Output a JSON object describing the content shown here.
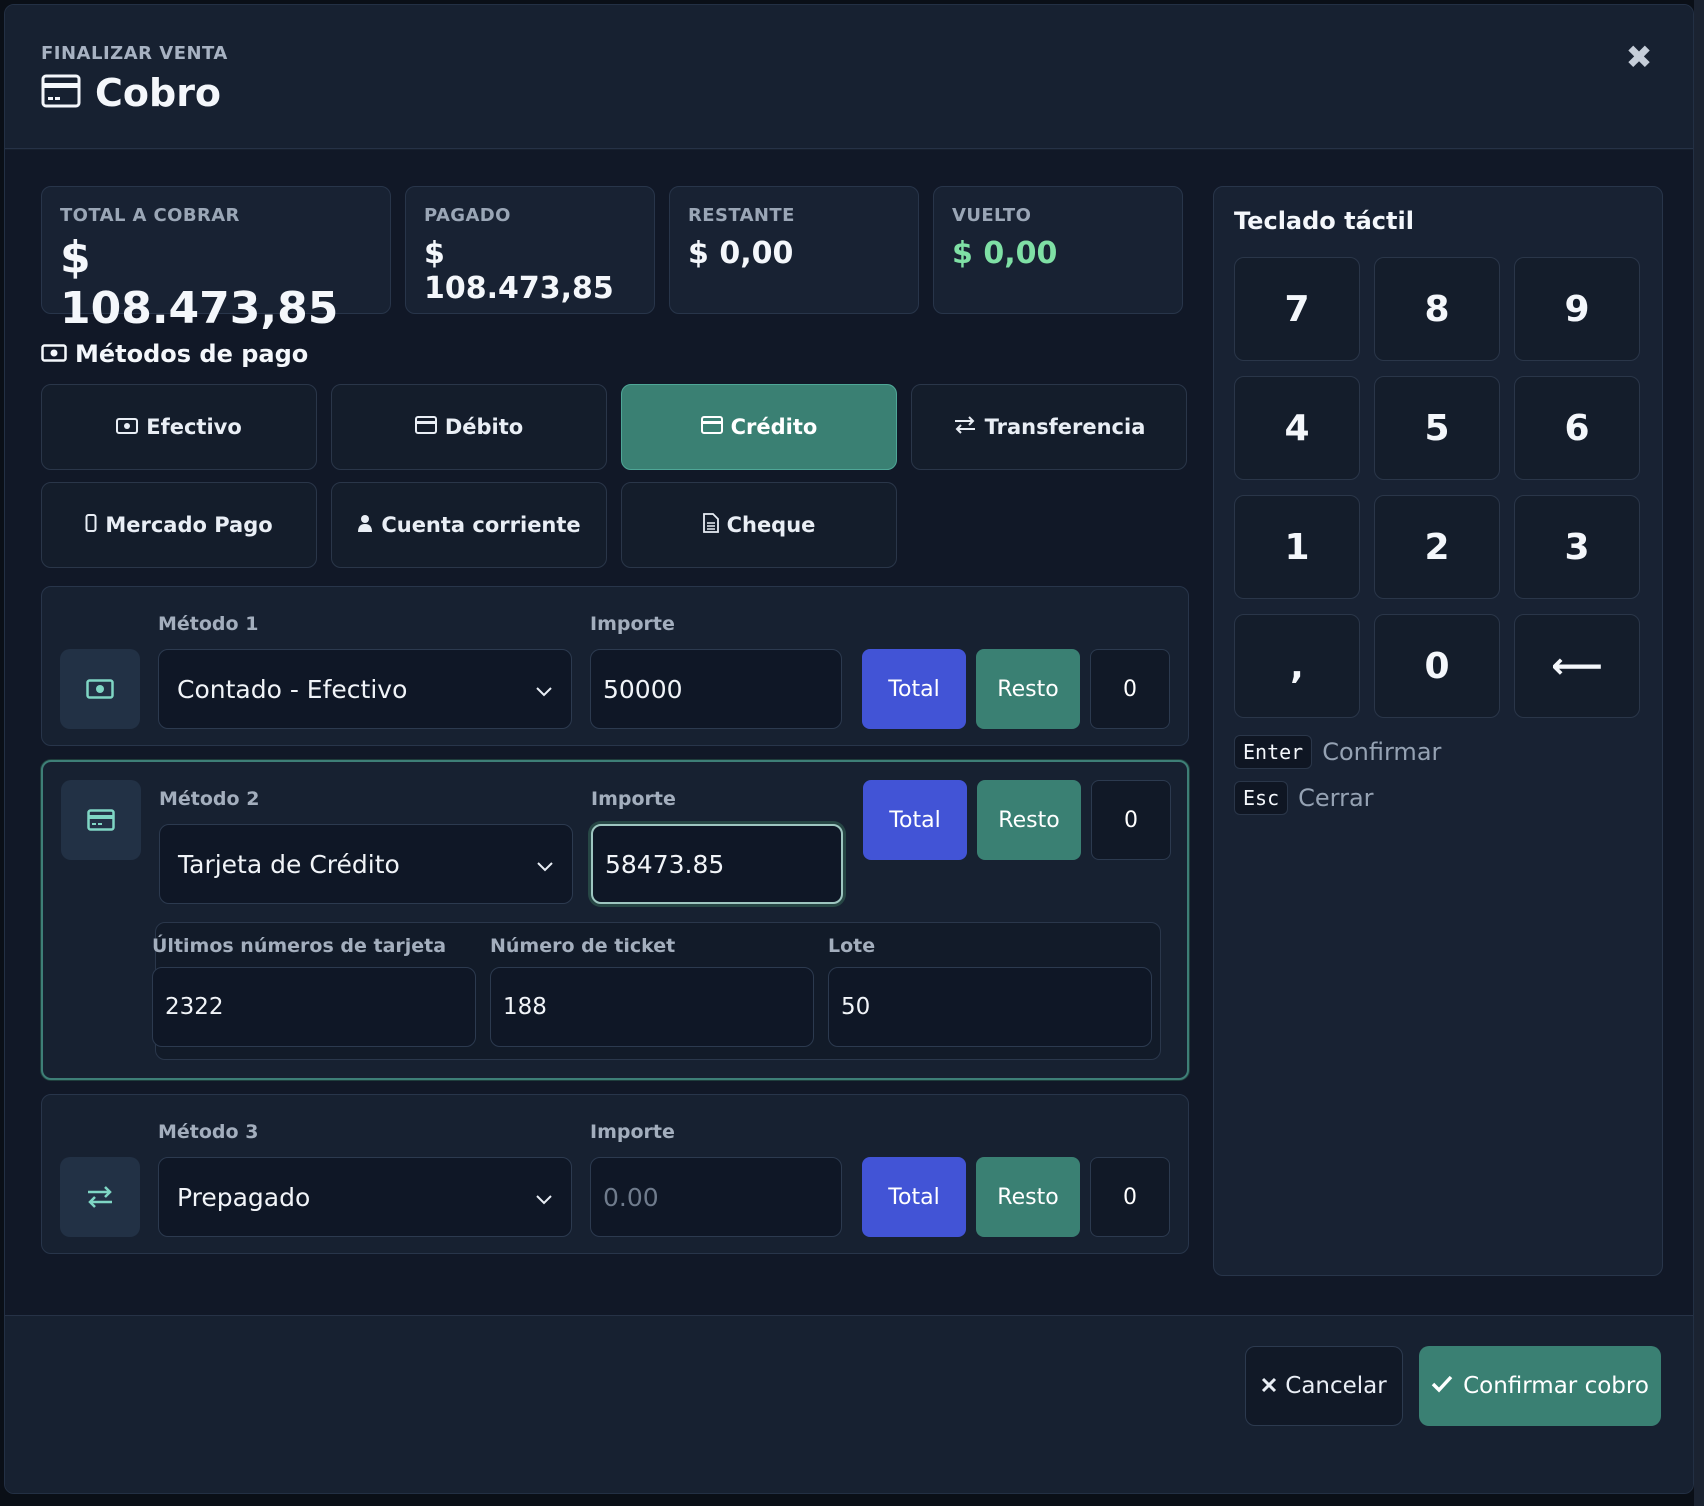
{
  "header": {
    "eyebrow": "FINALIZAR VENTA",
    "title": "Cobro",
    "close_label": "✖"
  },
  "summary": {
    "total": {
      "label": "TOTAL A COBRAR",
      "value": "$ 108.473,85"
    },
    "paid": {
      "label": "PAGADO",
      "value": "$ 108.473,85"
    },
    "remaining": {
      "label": "RESTANTE",
      "value": "$ 0,00"
    },
    "change": {
      "label": "VUELTO",
      "value": "$ 0,00"
    }
  },
  "methods_section": {
    "title": "Métodos de pago",
    "buttons": [
      {
        "label": "Efectivo",
        "icon": "cash-icon",
        "active": false
      },
      {
        "label": "Débito",
        "icon": "card-icon",
        "active": false
      },
      {
        "label": "Crédito",
        "icon": "card-icon",
        "active": true
      },
      {
        "label": "Transferencia",
        "icon": "transfer-icon",
        "active": false
      },
      {
        "label": "Mercado Pago",
        "icon": "phone-icon",
        "active": false
      },
      {
        "label": "Cuenta corriente",
        "icon": "user-icon",
        "active": false
      },
      {
        "label": "Cheque",
        "icon": "document-icon",
        "active": false
      }
    ]
  },
  "payment_rows": [
    {
      "method_label": "Método 1",
      "amount_label": "Importe",
      "method": "Contado - Efectivo",
      "amount": "50000",
      "amount_placeholder": "0.00",
      "total_label": "Total",
      "rest_label": "Resto",
      "zero_label": "0",
      "icon": "cash-icon"
    },
    {
      "method_label": "Método 2",
      "amount_label": "Importe",
      "method": "Tarjeta de Crédito",
      "amount": "58473.85",
      "amount_placeholder": "0.00",
      "total_label": "Total",
      "rest_label": "Resto",
      "zero_label": "0",
      "icon": "card-icon",
      "card_details": {
        "last_digits_label": "Últimos números de tarjeta",
        "last_digits": "2322",
        "ticket_label": "Número de ticket",
        "ticket": "188",
        "batch_label": "Lote",
        "batch": "50"
      }
    },
    {
      "method_label": "Método 3",
      "amount_label": "Importe",
      "method": "Prepagado",
      "amount": "",
      "amount_placeholder": "0.00",
      "total_label": "Total",
      "rest_label": "Resto",
      "zero_label": "0",
      "icon": "transfer-icon"
    }
  ],
  "keypad": {
    "title": "Teclado táctil",
    "keys": [
      "7",
      "8",
      "9",
      "4",
      "5",
      "6",
      "1",
      "2",
      "3",
      ",",
      "0",
      "⟵"
    ],
    "shortcuts": [
      {
        "key": "Enter",
        "label": "Confirmar"
      },
      {
        "key": "Esc",
        "label": "Cerrar"
      }
    ]
  },
  "footer": {
    "cancel_label": "Cancelar",
    "confirm_label": "Confirmar cobro"
  },
  "colors": {
    "accent_green": "#3a8073",
    "accent_blue": "#4254d6",
    "change_green": "#7fe0a5"
  }
}
